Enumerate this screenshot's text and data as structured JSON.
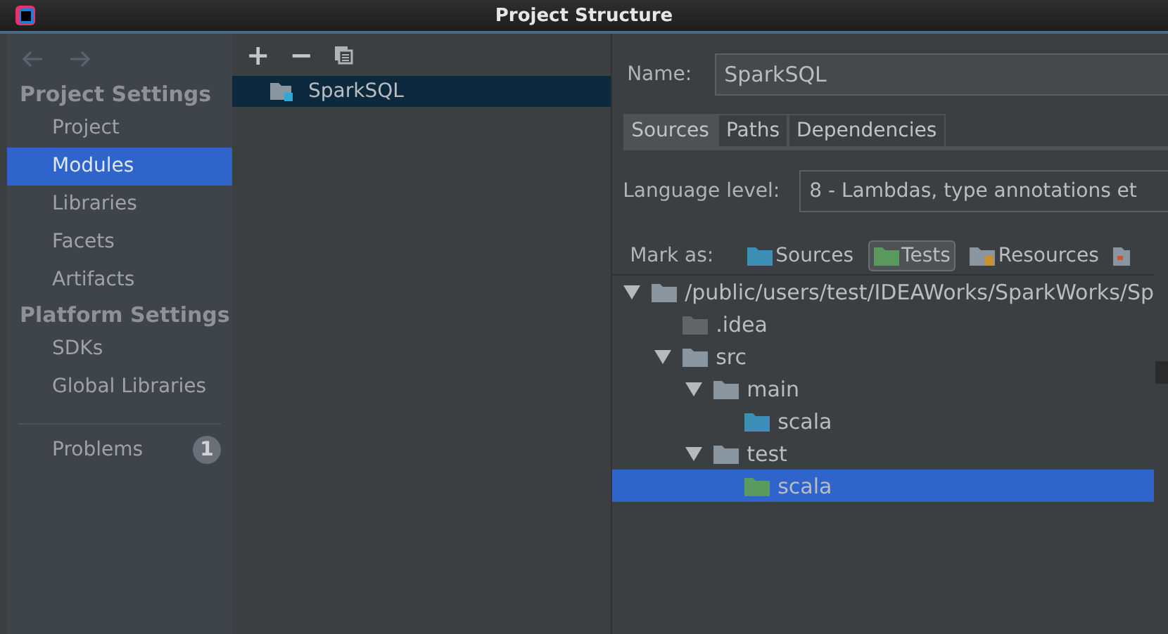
{
  "window": {
    "title": "Project Structure"
  },
  "sidebar": {
    "items": [
      {
        "kind": "header",
        "label": "Project Settings"
      },
      {
        "kind": "item",
        "label": "Project",
        "selected": false
      },
      {
        "kind": "item",
        "label": "Modules",
        "selected": true
      },
      {
        "kind": "item",
        "label": "Libraries",
        "selected": false
      },
      {
        "kind": "item",
        "label": "Facets",
        "selected": false
      },
      {
        "kind": "item",
        "label": "Artifacts",
        "selected": false
      },
      {
        "kind": "header",
        "label": "Platform Settings"
      },
      {
        "kind": "item",
        "label": "SDKs",
        "selected": false
      },
      {
        "kind": "item",
        "label": "Global Libraries",
        "selected": false
      }
    ],
    "problems": {
      "label": "Problems",
      "count": "1"
    }
  },
  "modules": {
    "toolbar": [
      "+",
      "−"
    ],
    "items": [
      {
        "label": "SparkSQL",
        "selected": true
      }
    ]
  },
  "name_field": {
    "label": "Name:",
    "value": "SparkSQL"
  },
  "tabs": [
    {
      "label": "Sources",
      "selected": true
    },
    {
      "label": "Paths",
      "selected": false
    },
    {
      "label": "Dependencies",
      "selected": false
    }
  ],
  "language_level": {
    "label": "Language level:",
    "value": "8 - Lambdas, type annotations et"
  },
  "mark_as": {
    "label": "Mark as:",
    "buttons": [
      {
        "kind": "source",
        "label": "Sources",
        "selected": false
      },
      {
        "kind": "test",
        "label": "Tests",
        "selected": true
      },
      {
        "kind": "resource",
        "label": "Resources",
        "selected": false
      }
    ]
  },
  "tree": [
    {
      "label": "/public/users/test/IDEAWorks/SparkWorks/Sp",
      "kind": "plain",
      "expanded": true,
      "selected": false,
      "children": [
        {
          "label": ".idea",
          "kind": "excluded",
          "selected": false
        },
        {
          "label": "src",
          "kind": "plain",
          "expanded": true,
          "selected": false,
          "children": [
            {
              "label": "main",
              "kind": "plain",
              "expanded": true,
              "selected": false,
              "children": [
                {
                  "label": "scala",
                  "kind": "source",
                  "selected": false
                }
              ]
            },
            {
              "label": "test",
              "kind": "plain",
              "expanded": true,
              "selected": false,
              "children": [
                {
                  "label": "scala",
                  "kind": "test",
                  "selected": true
                }
              ]
            }
          ]
        }
      ]
    }
  ]
}
